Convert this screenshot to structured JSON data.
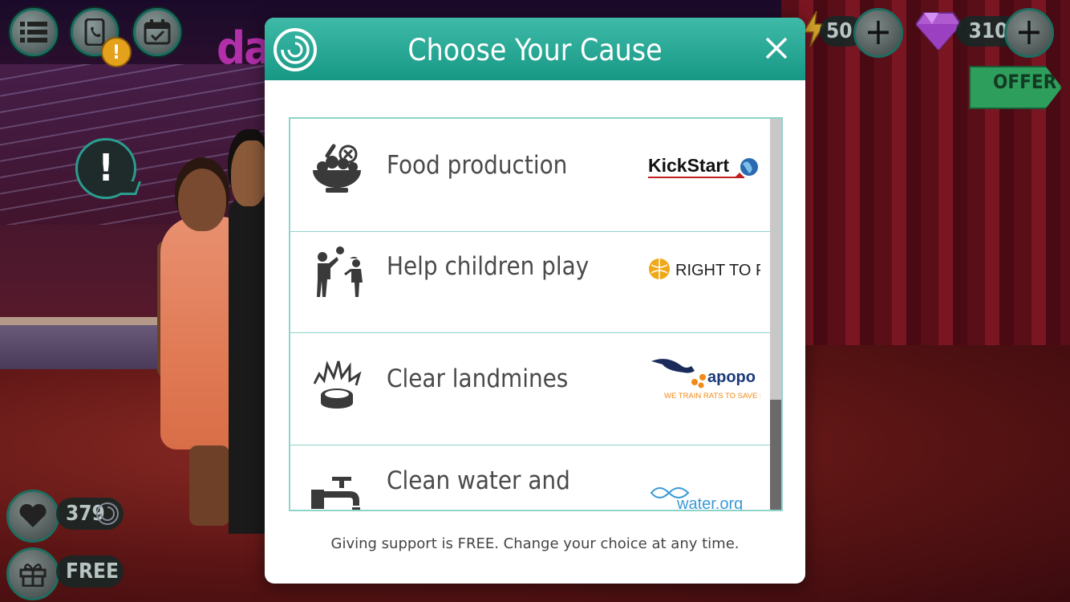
{
  "hud": {
    "energy_count": "50",
    "gem_count": "310",
    "offer_label": "OFFER",
    "hearts_count": "379",
    "gift_label": "FREE",
    "alert_symbol": "!",
    "warning_symbol": "!",
    "logo_fragment": "da"
  },
  "modal": {
    "title": "Choose Your Cause",
    "footer": "Giving support is FREE. Change your choice at any time.",
    "causes": [
      {
        "label": "Food production",
        "icon": "food-bowl-icon",
        "partner": "KickStart"
      },
      {
        "label": "Help children play",
        "icon": "children-play-icon",
        "partner": "RIGHT TO PLAY"
      },
      {
        "label": "Clear landmines",
        "icon": "landmine-icon",
        "partner": "apopo",
        "partner_tagline": "WE TRAIN RATS TO SAVE LIVES"
      },
      {
        "label": "Clean water and",
        "icon": "water-tap-icon",
        "partner": "water.org"
      }
    ],
    "accent_color": "#169885"
  }
}
